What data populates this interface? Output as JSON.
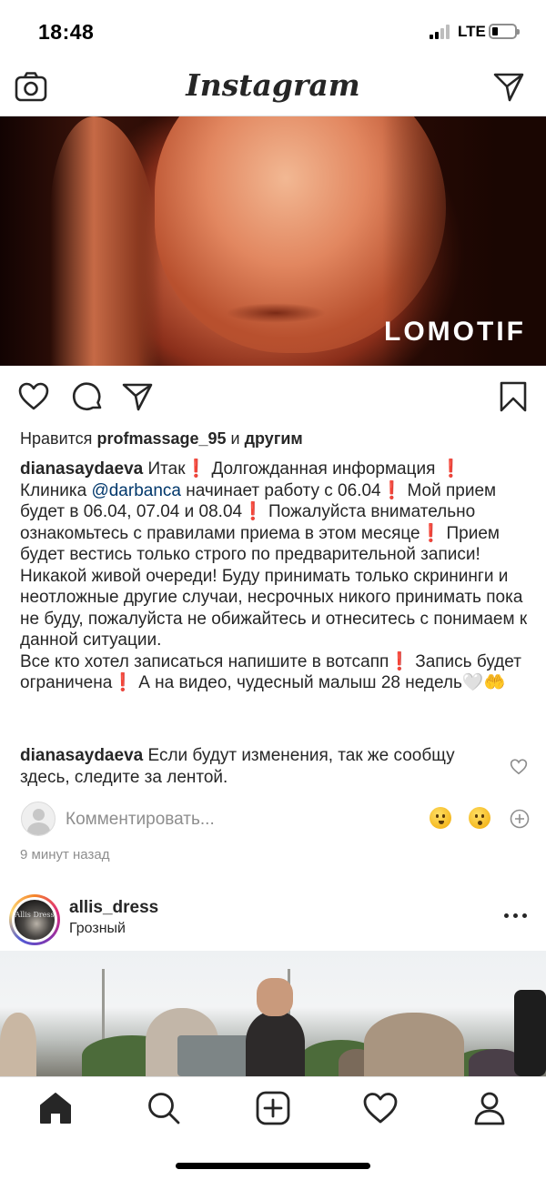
{
  "status_bar": {
    "time": "18:48",
    "network": "LTE",
    "battery_level": 0.25
  },
  "header": {
    "brand": "Instagram",
    "icons": [
      "camera-icon",
      "direct-send-icon"
    ]
  },
  "post": {
    "media_watermark": "LOMOTIF",
    "likes": {
      "prefix": "Нравится",
      "user": "profmassage_95",
      "joiner": "и",
      "suffix": "другим"
    },
    "caption": {
      "username": "dianasaydaeva",
      "part1": "Итак❗️ Долгожданная информация ❗️ Клиника ",
      "mention": "@darbanca",
      "part2": " начинает работу с 06.04❗️ Мой прием будет в 06.04, 07.04 и 08.04❗️ Пожалуйста внимательно ознакомьтесь с правилами приема в этом месяце❗️ Прием будет вестись только строго по предварительной записи! Никакой живой очереди! Буду принимать только скрининги и неотложные другие случаи, несрочных никого принимать пока не буду, пожалуйста не обижайтесь и отнеситесь с понимаем к данной ситуации.",
      "part3": "Все кто хотел записаться напишите в вотсапп❗️ Запись будет ограничена❗️ А на видео, чудесный малыш 28 недель🤍🤲"
    },
    "comment": {
      "username": "dianasaydaeva",
      "text": "Если будут изменения, так же сообщу здесь, следите за лентой."
    },
    "add_comment_placeholder": "Комментировать...",
    "quick_emojis": [
      "thinking-face-emoji",
      "kissing-face-emoji"
    ],
    "timestamp": "9 минут назад"
  },
  "next_post": {
    "username": "allis_dress",
    "location": "Грозный",
    "avatar_text": "Allis Dress"
  },
  "tab_bar": {
    "tabs": [
      "home-icon",
      "search-icon",
      "new-post-icon",
      "activity-heart-icon",
      "profile-icon"
    ],
    "active": "home-icon"
  }
}
